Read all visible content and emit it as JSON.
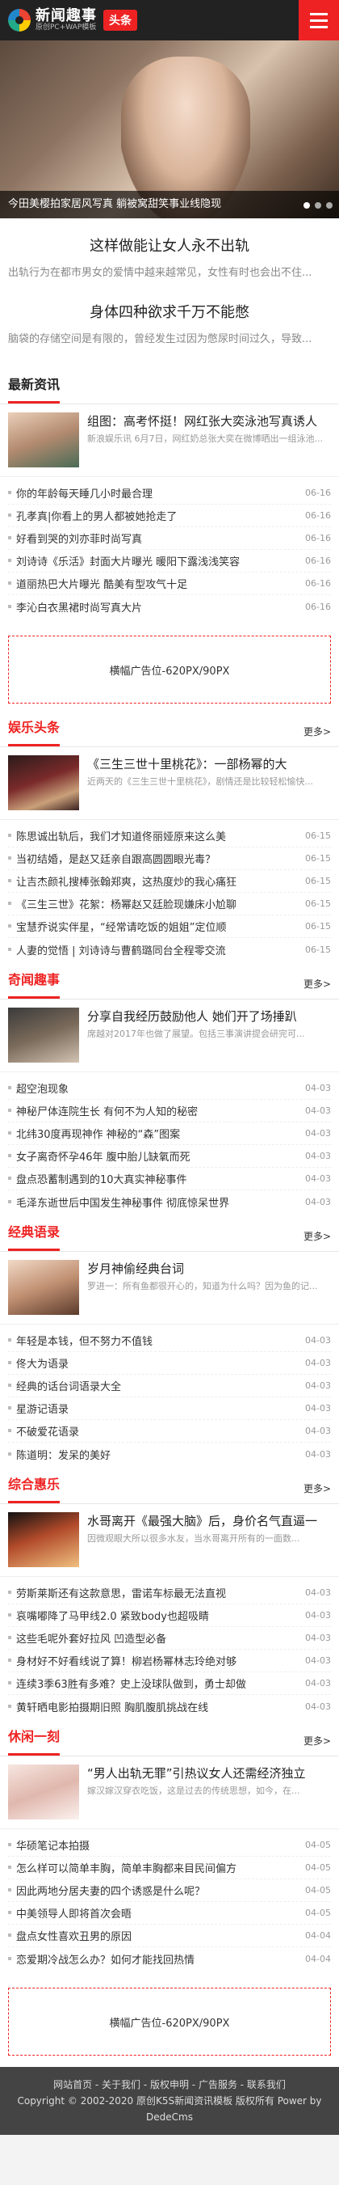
{
  "header": {
    "logo_main": "新闻趣事",
    "logo_sub": "原创PC+WAP模板",
    "logo_tag": "头条"
  },
  "slider": {
    "caption": "今田美樱拍家居风写真 躺被窝甜笑事业线隐现",
    "dots": 3,
    "active_dot": 0
  },
  "intro": [
    {
      "title": "这样做能让女人永不出轨",
      "desc": "出轨行为在都市男女的爱情中越来越常见，女性有时也会出不住..."
    },
    {
      "title": "身体四种欲求千万不能憋",
      "desc": "脑袋的存储空间是有限的，曾经发生过因为憋尿时间过久，导致..."
    }
  ],
  "sections": [
    {
      "title": "最新资讯",
      "title_red": false,
      "more": "",
      "top": {
        "title": "组图：高考怀挺！网红张大奕泳池写真诱人",
        "desc": "新浪娱乐讯 6月7日，网红奶总张大奕在微博晒出一组泳池..."
      },
      "items": [
        {
          "title": "你的年龄每天睡几小时最合理",
          "date": "06-16"
        },
        {
          "title": "孔孝真|你看上的男人都被她抢走了",
          "date": "06-16"
        },
        {
          "title": "好看到哭的刘亦菲时尚写真",
          "date": "06-16"
        },
        {
          "title": "刘诗诗《乐活》封面大片曝光 暖阳下露浅浅笑容",
          "date": "06-16"
        },
        {
          "title": "道丽热巴大片曝光 酷美有型攻气十足",
          "date": "06-16"
        },
        {
          "title": "李沁白衣黑裙时尚写真大片",
          "date": "06-16"
        }
      ],
      "ad": "横幅广告位-620PX/90PX"
    },
    {
      "title": "娱乐头条",
      "title_red": true,
      "more": "更多>",
      "top": {
        "title": "《三生三世十里桃花》：一部杨幂的大",
        "desc": "近两天的《三生三世十里桃花》，剧情还是比较轻松愉快..."
      },
      "items": [
        {
          "title": "陈思诚出轨后，我们才知道佟丽娅原来这么美",
          "date": "06-15"
        },
        {
          "title": "当初结婚，是赵又廷亲自跟高圆圆眼光毒？",
          "date": "06-15"
        },
        {
          "title": "让吉杰颜礼搜棒张翰郑爽，这热度炒的我心痛狂",
          "date": "06-15"
        },
        {
          "title": "《三生三世》花絮：杨幂赵又廷脸现嫌床小尬聊",
          "date": "06-15"
        },
        {
          "title": "宝慧乔说实伴星，“经常请吃饭的姐姐”定位顺",
          "date": "06-15"
        },
        {
          "title": "人妻的觉悟 | 刘诗诗与曹鹤璐同台全程零交流",
          "date": "06-15"
        }
      ],
      "ad": ""
    },
    {
      "title": "奇闻趣事",
      "title_red": true,
      "more": "更多>",
      "top": {
        "title": "分享自我经历鼓励他人 她们开了场捶趴",
        "desc": "席越对2017年也做了展望。包括三事演讲提会研完可..."
      },
      "items": [
        {
          "title": "超空泡现象",
          "date": "04-03"
        },
        {
          "title": "神秘尸体连院生长 有何不为人知的秘密",
          "date": "04-03"
        },
        {
          "title": "北纬30度再现神作 神秘的“森”图案",
          "date": "04-03"
        },
        {
          "title": "女子离奇怀孕46年 腹中胎儿缺氧而死",
          "date": "04-03"
        },
        {
          "title": "盘点恐蓄制遇到的10大真实神秘事件",
          "date": "04-03"
        },
        {
          "title": "毛泽东逝世后中国发生神秘事件 彻底惊呆世界",
          "date": "04-03"
        }
      ],
      "ad": ""
    },
    {
      "title": "经典语录",
      "title_red": true,
      "more": "更多>",
      "top": {
        "title": "岁月神偷经典台词",
        "desc": "罗进一：所有鱼都很开心的，知道为什么吗？因为鱼的记..."
      },
      "items": [
        {
          "title": "年轻是本钱，但不努力不值钱",
          "date": "04-03"
        },
        {
          "title": "佟大为语录",
          "date": "04-03"
        },
        {
          "title": "经典的话台词语录大全",
          "date": "04-03"
        },
        {
          "title": "星游记语录",
          "date": "04-03"
        },
        {
          "title": "不破爱花语录",
          "date": "04-03"
        },
        {
          "title": "陈道明：发呆的美好",
          "date": "04-03"
        }
      ],
      "ad": ""
    },
    {
      "title": "综合惠乐",
      "title_red": true,
      "more": "更多>",
      "top": {
        "title": "水哥离开《最强大脑》后，身价名气直逼一",
        "desc": "因微观眼大所以很多水友，当水哥离开所有的一面数..."
      },
      "items": [
        {
          "title": "劳斯莱斯还有这款意思，雷诺车标最无法直视",
          "date": "04-03"
        },
        {
          "title": "哀嘴嘟降了马甲线2.0 紧致body也超吸睛",
          "date": "04-03"
        },
        {
          "title": "这些毛呢外套好拉风 凹造型必备",
          "date": "04-03"
        },
        {
          "title": "身材好不好看线说了算！柳岩杨幂林志玲绝对够",
          "date": "04-03"
        },
        {
          "title": "连续3季63胜有多难？史上没球队做到，勇士却做",
          "date": "04-03"
        },
        {
          "title": "黄轩晒电影拍摄期旧照 胸肌腹肌挑战在线",
          "date": "04-03"
        }
      ],
      "ad": ""
    },
    {
      "title": "休闲一刻",
      "title_red": true,
      "more": "更多>",
      "top": {
        "title": "“男人出轨无罪”引热议女人还需经济独立",
        "desc": "嫁汉嫁汉穿衣吃饭，这是过去的传统思想，如今，在..."
      },
      "items": [
        {
          "title": "华硕笔记本拍摄",
          "date": "04-05"
        },
        {
          "title": "怎么样可以简单丰胸，简单丰胸都来目民间偏方",
          "date": "04-05"
        },
        {
          "title": "因此两地分居夫妻的四个诱惑是什么呢？",
          "date": "04-05"
        },
        {
          "title": "中美领导人即将首次会晤",
          "date": "04-05"
        },
        {
          "title": "盘点女性喜欢丑男的原因",
          "date": "04-04"
        },
        {
          "title": "恋爱期冷战怎么办？如何才能找回热情",
          "date": "04-04"
        }
      ],
      "ad": "横幅广告位-620PX/90PX"
    }
  ],
  "footer": {
    "links": "网站首页 - 关于我们 - 版权申明 - 广告服务 - 联系我们",
    "copyright": "Copyright © 2002-2020 原创K5S新闻资讯模板 版权所有 Power by DedeCms"
  },
  "colors": {
    "accent": "#e22222",
    "header_bg": "#222222",
    "footer_bg": "#444444"
  }
}
